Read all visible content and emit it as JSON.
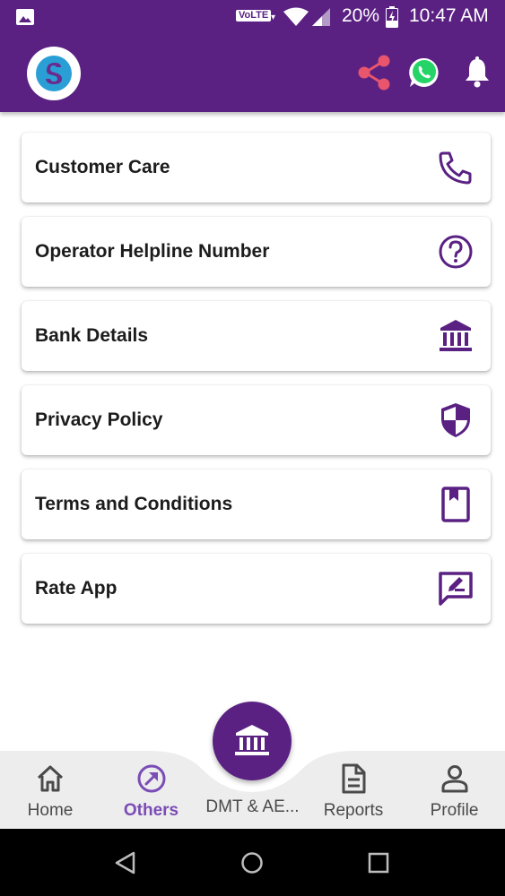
{
  "status_bar": {
    "network_badge": "VoLTE",
    "battery_percent": "20%",
    "time": "10:47 AM"
  },
  "app_bar": {
    "icons": [
      "logo",
      "share-icon",
      "whatsapp-icon",
      "bell-icon"
    ]
  },
  "menu": {
    "items": [
      {
        "label": "Customer Care",
        "icon": "phone-icon"
      },
      {
        "label": "Operator Helpline Number",
        "icon": "help-circle-icon"
      },
      {
        "label": "Bank Details",
        "icon": "bank-icon"
      },
      {
        "label": "Privacy Policy",
        "icon": "shield-icon"
      },
      {
        "label": "Terms and Conditions",
        "icon": "book-icon"
      },
      {
        "label": "Rate App",
        "icon": "rate-feedback-icon"
      }
    ]
  },
  "bottom_nav": {
    "items": [
      {
        "label": "Home",
        "icon": "home-icon",
        "active": false
      },
      {
        "label": "Others",
        "icon": "others-arrow-icon",
        "active": true
      },
      {
        "label": "DMT & AE...",
        "icon": "bank-icon",
        "active": false
      },
      {
        "label": "Reports",
        "icon": "document-icon",
        "active": false
      },
      {
        "label": "Profile",
        "icon": "person-icon",
        "active": false
      }
    ]
  },
  "colors": {
    "primary": "#5a2183",
    "active_nav": "#7a4cb6",
    "share": "#e8556d",
    "whatsapp": "#25d366"
  }
}
